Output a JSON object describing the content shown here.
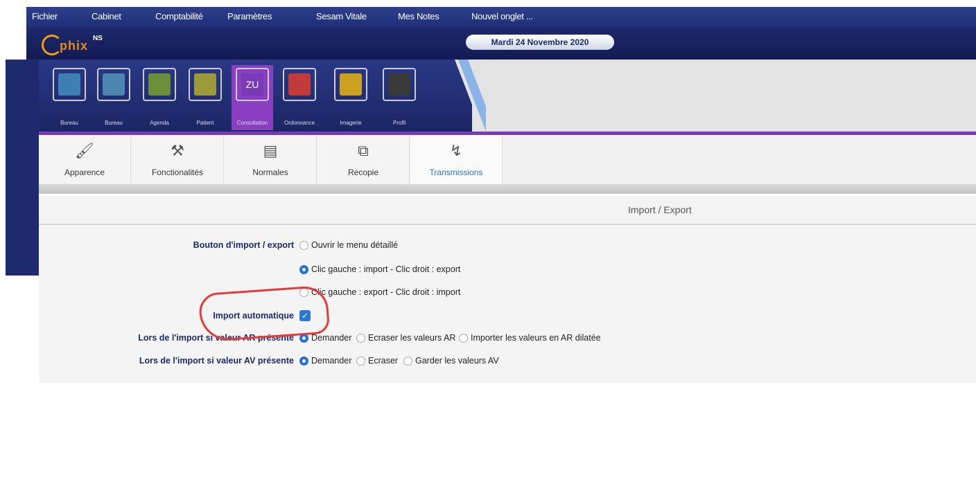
{
  "menu": [
    "Fichier",
    "Cabinet",
    "Comptabilité",
    "Paramètres",
    "Sesam Vitale",
    "Mes Notes",
    "Nouvel onglet ..."
  ],
  "logo": {
    "text": "phix",
    "sup": "NS"
  },
  "date": "Mardi 24 Novembre 2020",
  "modules": [
    {
      "label": "Bureau",
      "color": "#3d7fb0"
    },
    {
      "label": "Bureau",
      "color": "#4b85b0"
    },
    {
      "label": "Agenda",
      "color": "#6b8e3a"
    },
    {
      "label": "Patient",
      "color": "#9a9a3a"
    },
    {
      "label": "Consultation",
      "color": "#7a3ab5",
      "badge": "ZU"
    },
    {
      "label": "Ordonnance",
      "color": "#c23b3b"
    },
    {
      "label": "Imagerie",
      "color": "#caa21f"
    },
    {
      "label": "Profil",
      "color": "#3a3a3a"
    }
  ],
  "tabs": [
    {
      "label": "Apparence",
      "icon": "brush-icon",
      "glyph": "🖌"
    },
    {
      "label": "Fonctionalités",
      "icon": "tools-icon",
      "glyph": "⚒"
    },
    {
      "label": "Normales",
      "icon": "document-icon",
      "glyph": "▤"
    },
    {
      "label": "Recopie",
      "icon": "copy-icon",
      "glyph": "⧉"
    },
    {
      "label": "Transmissions",
      "icon": "transmit-icon",
      "glyph": "↯",
      "selected": true
    }
  ],
  "tab_marker": "▼",
  "section_title": "Import / Export",
  "form": {
    "import_button": {
      "label": "Bouton d'import / export",
      "options": [
        {
          "text": "Ouvrir le menu détaillé",
          "checked": false
        },
        {
          "text": "Clic gauche : import - Clic droit : export",
          "checked": true
        },
        {
          "text": "Clic gauche : export - Clic droit : import",
          "checked": false
        }
      ]
    },
    "auto_import": {
      "label": "Import automatique",
      "checked": true,
      "check_glyph": "✓"
    },
    "ar_present": {
      "label": "Lors de l'import si valeur AR présente",
      "options": [
        {
          "text": "Demander",
          "checked": true
        },
        {
          "text": "Ecraser les valeurs AR",
          "checked": false
        },
        {
          "text": "Importer les valeurs en AR dilatée",
          "checked": false
        }
      ]
    },
    "av_present": {
      "label": "Lors de l'import si valeur AV présente",
      "options": [
        {
          "text": "Demander",
          "checked": true
        },
        {
          "text": "Ecraser",
          "checked": false
        },
        {
          "text": "Garder les valeurs AV",
          "checked": false
        }
      ]
    }
  }
}
